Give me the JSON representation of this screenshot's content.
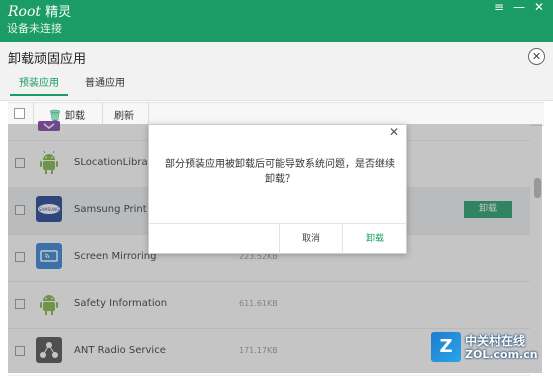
{
  "titlebar": {
    "brand_root": "Root",
    "brand_name": "精灵",
    "connection_status": "设备未连接",
    "menu_glyph": "≡",
    "min_glyph": "—",
    "close_glyph": "✕"
  },
  "panel": {
    "title": "卸载顽固应用",
    "close_glyph": "✕",
    "tabs": [
      {
        "label": "预装应用",
        "active": true
      },
      {
        "label": "普通应用",
        "active": false
      }
    ]
  },
  "toolbar": {
    "trash_glyph": "🗑",
    "uninstall_label": "卸载",
    "refresh_label": "刷新"
  },
  "apps": [
    {
      "name": "",
      "size": "",
      "icon": "android-icon-partial"
    },
    {
      "name": "SLocationLibrary",
      "size": "",
      "icon": "android-icon"
    },
    {
      "name": "Samsung Print Se",
      "size": "",
      "icon": "samsung-print-icon",
      "highlighted": true,
      "button_label": "卸载"
    },
    {
      "name": "Screen Mirroring",
      "size": "223.52KB",
      "icon": "screen-mirroring-icon"
    },
    {
      "name": "Safety Information",
      "size": "611.61KB",
      "icon": "android-icon"
    },
    {
      "name": "ANT Radio Service",
      "size": "171.17KB",
      "icon": "ant-radio-icon"
    }
  ],
  "dialog": {
    "close_glyph": "✕",
    "message": "部分预装应用被卸载后可能导致系统问题，是否继续卸载？",
    "cancel_label": "取消",
    "confirm_label": "卸载"
  },
  "watermark": {
    "mark": "Z",
    "text_cn": "中关村在线",
    "url": "ZOL.com.cn"
  },
  "colors": {
    "brand_green": "#1b9c66",
    "overlay": "rgba(90,90,90,0.35)"
  }
}
